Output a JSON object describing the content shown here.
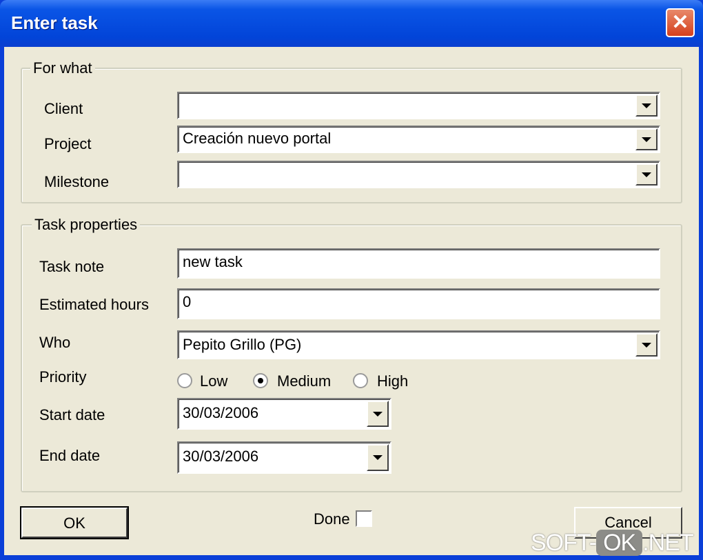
{
  "window": {
    "title": "Enter task"
  },
  "for_what": {
    "legend": "For what",
    "client_label": "Client",
    "client_value": "",
    "project_label": "Project",
    "project_value": "Creación nuevo portal",
    "milestone_label": "Milestone",
    "milestone_value": ""
  },
  "task_properties": {
    "legend": "Task properties",
    "task_note_label": "Task note",
    "task_note_value": "new task",
    "estimated_hours_label": "Estimated hours",
    "estimated_hours_value": "0",
    "who_label": "Who",
    "who_value": "Pepito Grillo (PG)",
    "priority_label": "Priority",
    "priority_options": [
      "Low",
      "Medium",
      "High"
    ],
    "priority_selected": "Medium",
    "start_date_label": "Start date",
    "start_date_value": "30/03/2006",
    "end_date_label": "End date",
    "end_date_value": "30/03/2006"
  },
  "footer": {
    "ok_label": "OK",
    "done_label": "Done",
    "done_checked": false,
    "cancel_label": "Cancel"
  },
  "watermark": {
    "left": "SOFT-",
    "mid": "OK",
    "right": ".NET"
  }
}
